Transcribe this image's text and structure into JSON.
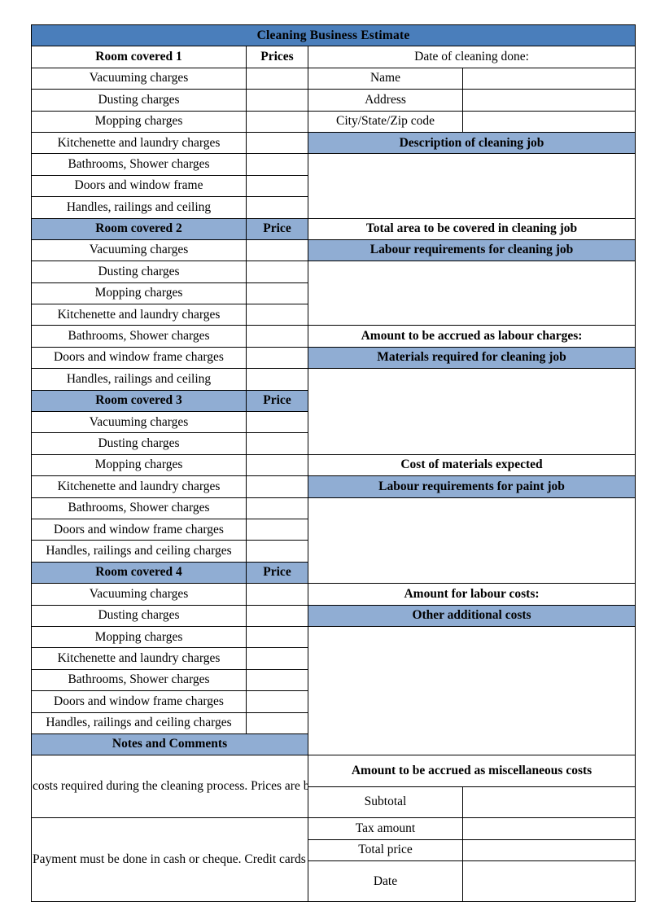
{
  "document": {
    "title": "Cleaning Business Estimate",
    "accent_dark": "#4A7EBB",
    "accent_light": "#90ADD3"
  },
  "left_column": {
    "price_header_1": "Prices",
    "price_header_other": "Price",
    "rooms": [
      {
        "header": "Room covered 1",
        "price_label": "Prices",
        "header_blue": false,
        "items": [
          "Vacuuming charges",
          "Dusting charges",
          "Mopping charges",
          "Kitchenette and laundry charges",
          "Bathrooms, Shower charges",
          "Doors and window frame",
          "Handles, railings and ceiling"
        ]
      },
      {
        "header": "Room covered 2",
        "price_label": "Price",
        "header_blue": true,
        "items": [
          "Vacuuming charges",
          "Dusting charges",
          "Mopping charges",
          "Kitchenette and laundry charges",
          "Bathrooms, Shower charges",
          "Doors and window frame charges",
          "Handles, railings and ceiling"
        ]
      },
      {
        "header": "Room covered 3",
        "price_label": "Price",
        "header_blue": true,
        "items": [
          "Vacuuming charges",
          "Dusting charges",
          "Mopping charges",
          "Kitchenette and laundry charges",
          "Bathrooms, Shower charges",
          "Doors and window frame charges",
          "Handles, railings and ceiling charges"
        ]
      },
      {
        "header": "Room covered 4",
        "price_label": "Price",
        "header_blue": true,
        "items": [
          "Vacuuming charges",
          "Dusting charges",
          "Mopping charges",
          "Kitchenette and laundry charges",
          "Bathrooms, Shower charges",
          "Doors and window frame charges",
          "Handles, railings and ceiling charges"
        ]
      }
    ],
    "notes": {
      "header": "Notes and Comments",
      "paragraph_1": "costs required during the cleaning process. Prices are based on current material costs and labour charges. These are subject to",
      "paragraph_2": "Payment must be done in cash or cheque. Credit cards are accepted as well [only VISA or MasterCard. Boucing of cheques is a criminal offence."
    }
  },
  "right_column": {
    "date_of_cleaning_label": "Date of cleaning done:",
    "customer_fields": [
      {
        "label": "Name",
        "value": ""
      },
      {
        "label": "Address",
        "value": ""
      },
      {
        "label": "City/State/Zip code",
        "value": ""
      }
    ],
    "description_header": "Description of cleaning job",
    "description_value": "",
    "total_area_label": "Total area to be covered in cleaning job",
    "labour_cleaning_header": "Labour requirements for cleaning job",
    "labour_cleaning_value": "",
    "labour_charges_label": "Amount to be accrued as labour charges:",
    "materials_header": "Materials required for cleaning job",
    "materials_value": "",
    "materials_cost_label": "Cost of materials expected",
    "labour_paint_header": "Labour requirements for paint job",
    "labour_paint_value": "",
    "labour_costs_label": "Amount for labour costs:",
    "other_costs_header": "Other additional costs",
    "other_costs_value": "",
    "misc_costs_label": "Amount to be accrued as miscellaneous costs",
    "totals": [
      {
        "label": "Subtotal",
        "value": ""
      },
      {
        "label": "Tax amount",
        "value": ""
      },
      {
        "label": "Total price",
        "value": ""
      },
      {
        "label": "Date",
        "value": ""
      }
    ]
  }
}
